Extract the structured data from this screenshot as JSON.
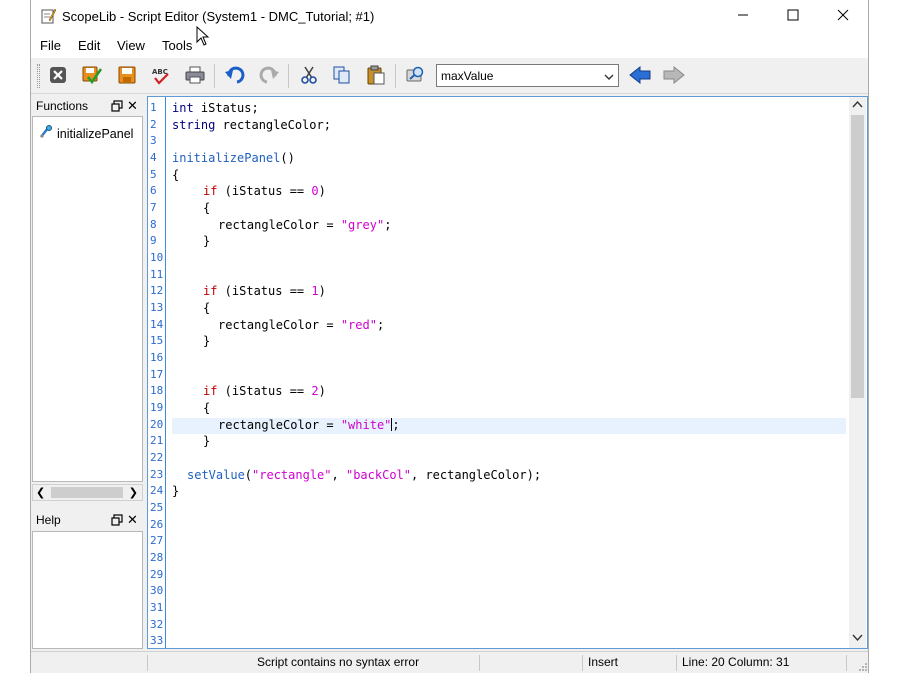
{
  "window": {
    "title": "ScopeLib - Script Editor (System1 - DMC_Tutorial; #1)",
    "app_icon": "script-editor-icon",
    "controls": {
      "minimize": "minimize-icon",
      "maximize": "maximize-icon",
      "close": "close-icon"
    }
  },
  "menu": {
    "items": [
      "File",
      "Edit",
      "View",
      "Tools"
    ]
  },
  "toolbar": {
    "buttons": [
      "close-script-icon",
      "save-check-icon",
      "save-icon",
      "spellcheck-icon",
      "print-icon",
      "undo-icon",
      "redo-icon",
      "cut-icon",
      "copy-icon",
      "paste-icon",
      "find-icon"
    ],
    "function_select": {
      "value": "maxValue"
    },
    "nav": [
      "back-arrow-icon",
      "forward-arrow-icon"
    ]
  },
  "functions_panel": {
    "title": "Functions",
    "items": [
      {
        "label": "initializePanel",
        "icon": "function-icon"
      }
    ]
  },
  "help_panel": {
    "title": "Help"
  },
  "editor": {
    "line_numbers": [
      "1",
      "2",
      "3",
      "4",
      "5",
      "6",
      "7",
      "8",
      "9",
      "10",
      "11",
      "12",
      "13",
      "14",
      "15",
      "16",
      "17",
      "18",
      "19",
      "20",
      "21",
      "22",
      "23",
      "24",
      "25",
      "26",
      "27",
      "28",
      "29",
      "30",
      "31",
      "32",
      "33"
    ],
    "active_line": 20,
    "code": {
      "l1_type": "int",
      "l1_rest": " iStatus;",
      "l2_type": "string",
      "l2_rest": " rectangleColor;",
      "l4_fn": "initializePanel",
      "l4_rest": "()",
      "l5": "{",
      "if_kw": "if",
      "l6_a": " (iStatus == ",
      "l6_num": "0",
      "l6_b": ")",
      "brace_open": "{",
      "brace_close": "}",
      "assign": "rectangleColor = ",
      "l8_str": "\"grey\"",
      "l12_num": "1",
      "l14_str": "\"red\"",
      "l18_num": "2",
      "l20_str": "\"white\"",
      "semi": ";",
      "l23_fn": "setValue",
      "l23_a": "(",
      "l23_s1": "\"rectangle\"",
      "l23_b": ", ",
      "l23_s2": "\"backCol\"",
      "l23_c": ", rectangleColor);",
      "l24": "}"
    }
  },
  "status": {
    "message": "Script contains no syntax error",
    "mode": "Insert",
    "position": "Line: 20 Column: 31"
  },
  "colors": {
    "keyword": "#000080",
    "control": "#c00000",
    "literal": "#d000d0",
    "function": "#2060c0",
    "gutter": "#2b6bd0"
  }
}
